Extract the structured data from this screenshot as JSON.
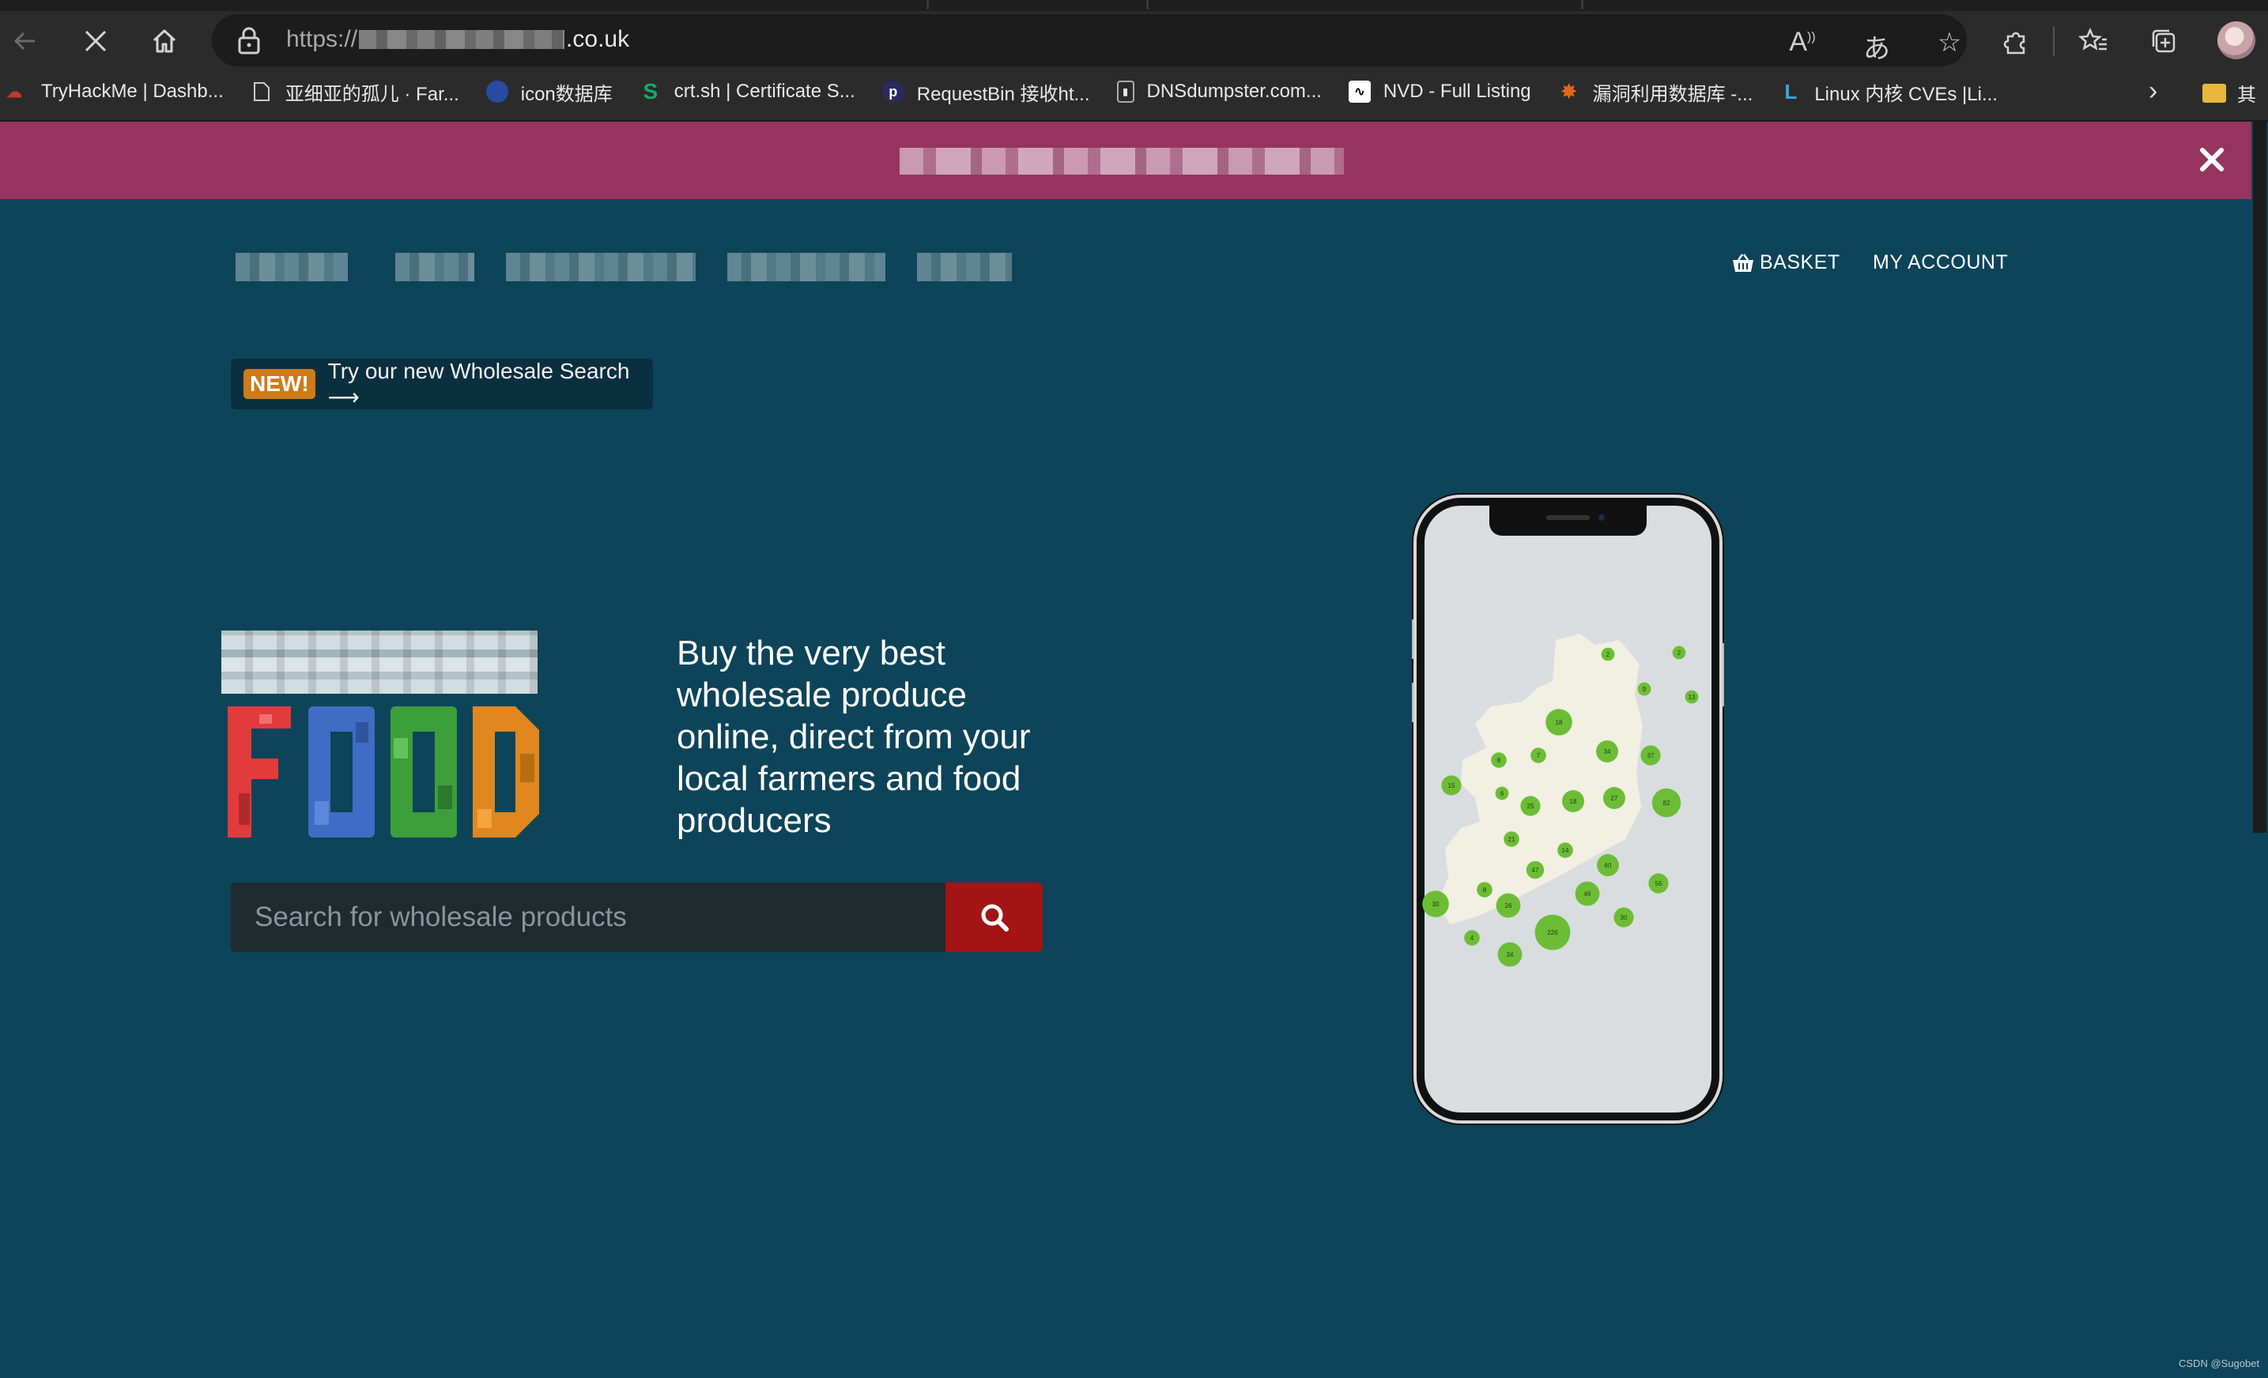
{
  "browser": {
    "url_scheme": "https://",
    "url_tail": ".co.uk",
    "bookmarks": [
      {
        "label": "TryHackMe | Dashb...",
        "icon": "tryhackme-icon",
        "color": "#c0392b"
      },
      {
        "label": "亚细亚的孤儿 · Far...",
        "icon": "document-icon",
        "color": "#cccccc"
      },
      {
        "label": "icon数据库",
        "icon": "globe-icon",
        "color": "#3b5db8"
      },
      {
        "label": "crt.sh | Certificate S...",
        "icon": "crtsh-icon",
        "color": "#18a86b"
      },
      {
        "label": "RequestBin 接收ht...",
        "icon": "requestbin-icon",
        "color": "#2a2a60"
      },
      {
        "label": "DNSdumpster.com...",
        "icon": "dnsdumpster-icon",
        "color": "#cccccc"
      },
      {
        "label": "NVD - Full Listing",
        "icon": "nvd-icon",
        "color": "#ffffff"
      },
      {
        "label": "漏洞利用数据库 -...",
        "icon": "exploitdb-icon",
        "color": "#e3651d"
      },
      {
        "label": "Linux 内核 CVEs |Li...",
        "icon": "linux-cve-icon",
        "color": "#3aa6d8"
      }
    ],
    "other_folder_label": "其"
  },
  "site": {
    "basket_label": "BASKET",
    "account_label": "MY ACCOUNT",
    "promo_badge": "NEW!",
    "promo_text": "Try our new Wholesale Search ⟶",
    "tagline": "Buy the very best wholesale produce online, direct from your local farmers and food producers",
    "search_placeholder": "Search for wholesale products",
    "logo_word": "FOOD",
    "logo_colors": [
      "#e23b3b",
      "#3f6cc4",
      "#3d9e3c",
      "#e0871f"
    ],
    "map_markers": [
      "2",
      "2",
      "9",
      "13",
      "18",
      "34",
      "37",
      "8",
      "7",
      "15",
      "6",
      "25",
      "18",
      "27",
      "82",
      "21",
      "14",
      "47",
      "60",
      "8",
      "56",
      "30",
      "26",
      "46",
      "30",
      "226",
      "4",
      "34"
    ],
    "accent_color": "#96345f",
    "background_color": "#0d4459",
    "search_button_color": "#a41414"
  },
  "watermark": "CSDN @Sugobet"
}
